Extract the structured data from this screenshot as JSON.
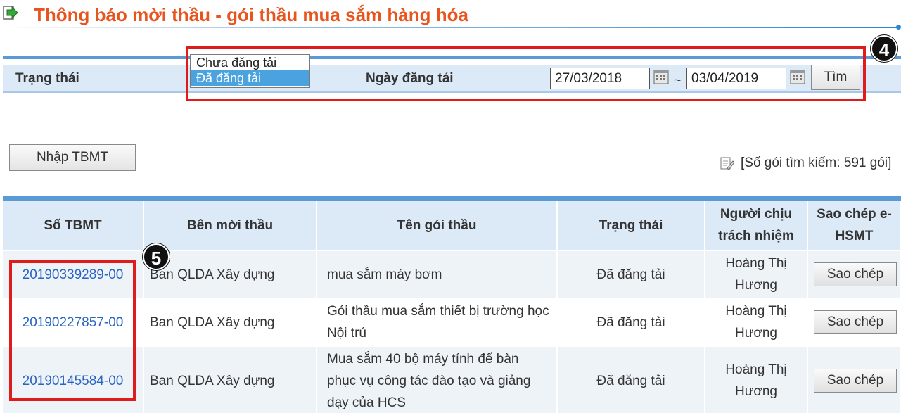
{
  "header": {
    "title": "Thông báo mời thầu - gói thầu mua sắm hàng hóa",
    "icon": "arrow-right-icon",
    "accent_color": "#e8541e"
  },
  "filter": {
    "status_label": "Trạng thái",
    "status_options": [
      "Chưa đăng tải",
      "Đã đăng tải"
    ],
    "status_selected": "Đã đăng tải",
    "date_label": "Ngày đăng tải",
    "date_from": "27/03/2018",
    "date_to": "03/04/2019",
    "date_separator": "~",
    "search_button": "Tìm",
    "annotation_badge": "4"
  },
  "toolbar": {
    "add_button": "Nhập TBMT",
    "result_count": "[Số gói tìm kiếm: 591 gói]"
  },
  "table": {
    "columns": [
      "Số TBMT",
      "Bên mời thầu",
      "Tên gói thầu",
      "Trạng thái",
      "Người chịu trách nhiệm",
      "Sao chép e-HSMT"
    ],
    "rows": [
      {
        "id": "20190339289-00",
        "inviter": "Ban QLDA Xây dựng",
        "package": "mua sắm máy bơm",
        "status": "Đã đăng tải",
        "person": "Hoàng Thị Hương",
        "action": "Sao chép"
      },
      {
        "id": "20190227857-00",
        "inviter": "Ban QLDA Xây dựng",
        "package": "Gói thầu mua sắm thiết bị trường học Nội trú",
        "status": "Đã đăng tải",
        "person": "Hoàng Thị Hương",
        "action": "Sao chép"
      },
      {
        "id": "20190145584-00",
        "inviter": "Ban QLDA Xây dựng",
        "package": "Mua sắm 40 bộ máy tính để bàn phục vụ công tác đào tạo và giảng dạy của HCS",
        "status": "Đã đăng tải",
        "person": "Hoàng Thị Hương",
        "action": "Sao chép"
      }
    ],
    "annotation_badge": "5"
  },
  "colors": {
    "header_band": "#dce9f7",
    "accent_blue": "#5b9bd5",
    "highlight_red": "#e01b1b",
    "link_blue": "#2864c4"
  }
}
